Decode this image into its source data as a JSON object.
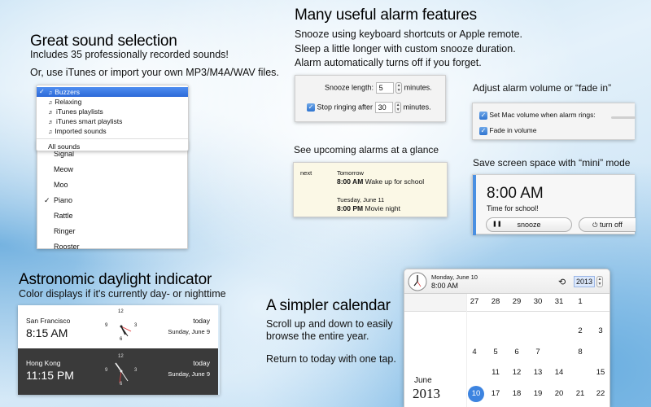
{
  "sound": {
    "heading": "Great sound selection",
    "line1": "Includes 35 professionally recorded sounds!",
    "line2": "Or, use iTunes or import your own MP3/M4A/WAV files.",
    "menu": [
      "Buzzers",
      "Relaxing",
      "iTunes playlists",
      "iTunes smart playlists",
      "Imported sounds"
    ],
    "menu_all": "All sounds",
    "list": [
      "Signal",
      "Meow",
      "Moo",
      "Piano",
      "Rattle",
      "Ringer",
      "Rooster"
    ]
  },
  "features": {
    "heading": "Many useful alarm features",
    "line1": "Snooze using keyboard shortcuts or Apple remote.",
    "line2": "Sleep a little longer with custom snooze duration.",
    "line3": "Alarm automatically turns off if you forget.",
    "snooze_label": "Snooze length:",
    "snooze_value": "5",
    "snooze_unit": "minutes.",
    "stop_label": "Stop ringing after",
    "stop_value": "30",
    "stop_unit": "minutes."
  },
  "volume": {
    "heading": "Adjust alarm volume or “fade in”",
    "opt1": "Set Mac volume when alarm rings:",
    "opt2": "Fade in volume"
  },
  "upcoming": {
    "heading": "See upcoming alarms at a glance",
    "next_label": "next",
    "alarms": [
      {
        "day": "Tomorrow",
        "time": "8:00 AM",
        "label": "Wake up for school"
      },
      {
        "day": "Tuesday, June 11",
        "time": "8:00 PM",
        "label": "Movie night"
      }
    ]
  },
  "mini": {
    "heading": "Save screen space with “mini” mode",
    "time": "8:00 AM",
    "message": "Time for school!",
    "snooze": "snooze",
    "turn_off": "turn off"
  },
  "daylight": {
    "heading": "Astronomic daylight indicator",
    "sub": "Color displays if it's currently day- or nighttime",
    "cities": [
      {
        "city": "San Francisco",
        "time": "8:15 AM",
        "rel": "today",
        "date": "Sunday, June 9"
      },
      {
        "city": "Hong Kong",
        "time": "11:15 PM",
        "rel": "today",
        "date": "Sunday, June 9"
      }
    ],
    "clock_numbers": [
      "12",
      "3",
      "6",
      "9"
    ]
  },
  "calendar_promo": {
    "heading": "A simpler calendar",
    "line1": "Scroll up and down to easily",
    "line2": "browse the entire year.",
    "line3": "Return to today with one tap."
  },
  "calendar": {
    "header_date": "Monday, June 10",
    "header_time": "8:00 AM",
    "year": "2013",
    "month_label": "June",
    "month_year": "2013",
    "row1": [
      "27",
      "28",
      "29",
      "30",
      "31",
      "1"
    ],
    "row2": [
      "4",
      "5",
      "6",
      "7",
      "8"
    ],
    "row3": [
      "11",
      "12",
      "13",
      "14",
      "15"
    ],
    "today": "10",
    "row4_left": [
      "2",
      "3"
    ],
    "row5": [
      "16",
      "17",
      "18",
      "19",
      "20",
      "21",
      "22"
    ]
  }
}
